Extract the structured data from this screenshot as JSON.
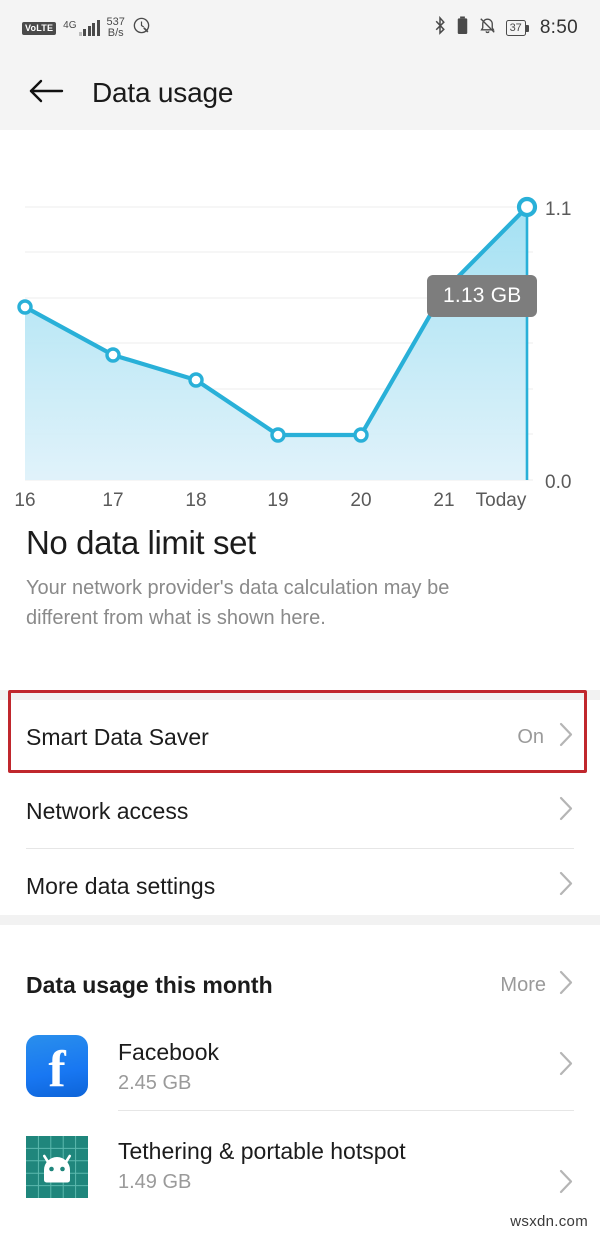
{
  "statusbar": {
    "volte": "VoLTE",
    "network_gen": "4G",
    "speed_value": "537",
    "speed_unit": "B/s",
    "battery_percent": "37",
    "time": "8:50",
    "icons": [
      "volte-badge",
      "signal-bars-icon",
      "data-speed-indicator",
      "eye-comfort-icon",
      "bluetooth-icon",
      "battery-saver-icon",
      "silent-mode-icon",
      "battery-icon"
    ]
  },
  "appbar": {
    "back_icon": "back-arrow-icon",
    "title": "Data usage"
  },
  "chart_data": {
    "type": "area",
    "title": "Daily data usage",
    "categories": [
      "16",
      "17",
      "18",
      "19",
      "20",
      "21",
      "Today"
    ],
    "values": [
      0.64,
      0.46,
      0.37,
      0.165,
      0.165,
      0.69,
      1.13
    ],
    "tooltip_label": "1.13 GB",
    "tooltip_value": 1.13,
    "xlabel": "",
    "ylabel": "",
    "ylim": [
      0.0,
      1.1
    ],
    "ytick_labels": [
      "1.1",
      "0.0"
    ],
    "grid": true,
    "legend": "none",
    "line_color": "#29b0d8",
    "fill_color": "#bde8f5",
    "unit": "GB"
  },
  "limit": {
    "title": "No data limit set",
    "subtitle": "Your network provider's data calculation may be different from what is shown here."
  },
  "settings_rows": [
    {
      "label": "Smart Data Saver",
      "value": "On",
      "highlighted": true
    },
    {
      "label": "Network access",
      "value": "",
      "highlighted": false
    },
    {
      "label": "More data settings",
      "value": "",
      "highlighted": false
    }
  ],
  "usage_section": {
    "title": "Data usage this month",
    "more_label": "More",
    "apps": [
      {
        "name": "Facebook",
        "size": "2.45 GB",
        "icon": "facebook-icon"
      },
      {
        "name": "Tethering & portable hotspot",
        "size": "1.49 GB",
        "icon": "android-robot-icon"
      }
    ]
  },
  "watermark": {
    "text": "wsxdn.com"
  },
  "colors": {
    "accent": "#29b0d8",
    "highlight_border": "#c0272d",
    "tooltip_bg": "#7d7d7d",
    "facebook_blue": "#1877f2",
    "tether_teal": "#1f867c"
  }
}
